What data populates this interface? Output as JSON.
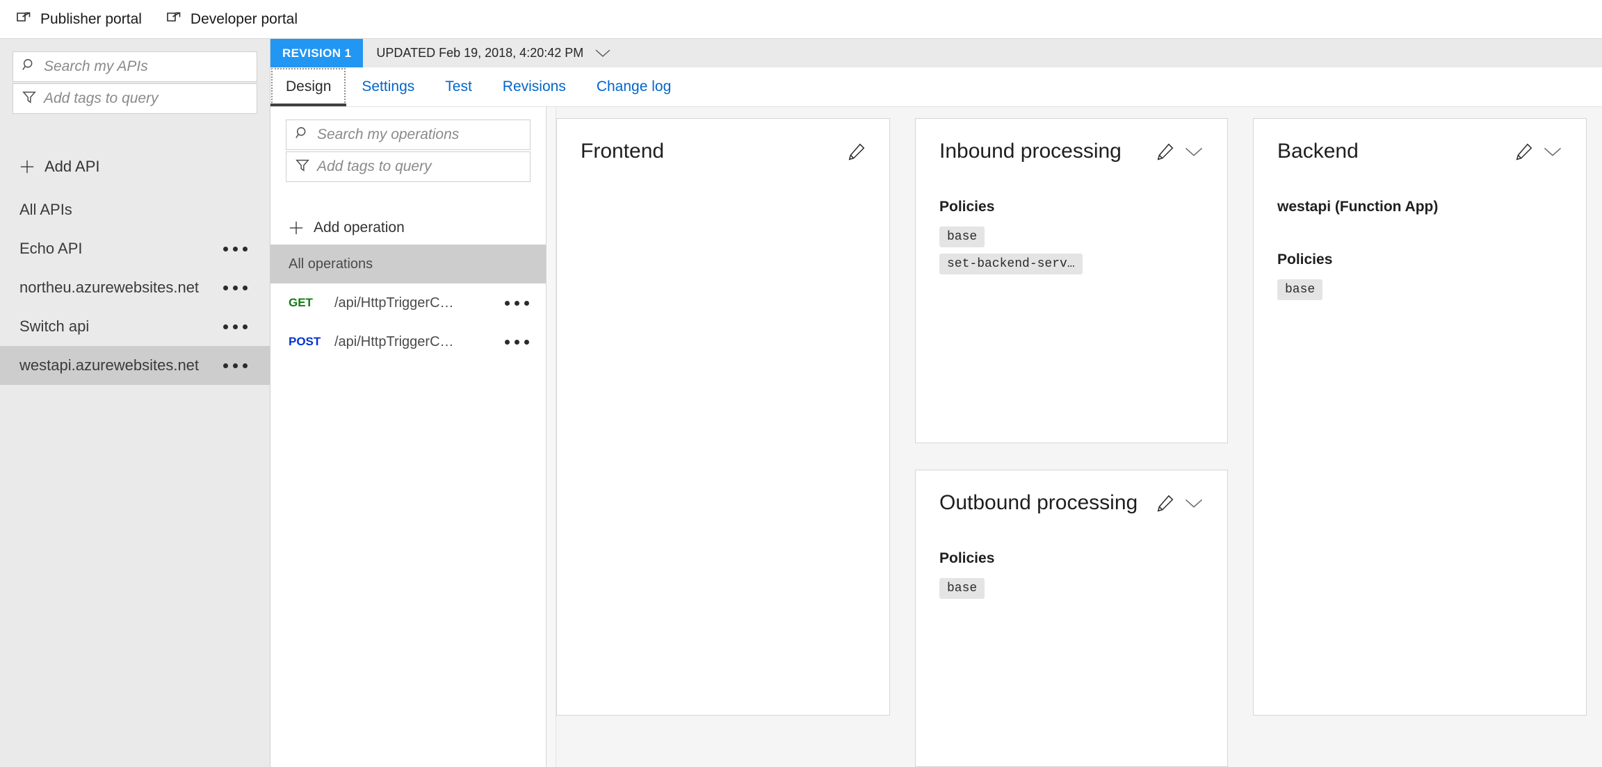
{
  "topbar": {
    "links": [
      {
        "label": "Publisher portal",
        "icon": "external-link-icon"
      },
      {
        "label": "Developer portal",
        "icon": "external-link-icon"
      }
    ]
  },
  "sidebar": {
    "search_placeholder": "Search my APIs",
    "tags_placeholder": "Add tags to query",
    "add_api_label": "Add API",
    "items": [
      {
        "label": "All APIs",
        "selected": false,
        "has_menu": false
      },
      {
        "label": "Echo API",
        "selected": false,
        "has_menu": true
      },
      {
        "label": "northeu.azurewebsites.net",
        "selected": false,
        "has_menu": true
      },
      {
        "label": "Switch api",
        "selected": false,
        "has_menu": true
      },
      {
        "label": "westapi.azurewebsites.net",
        "selected": true,
        "has_menu": true
      }
    ]
  },
  "revision_bar": {
    "badge": "REVISION 1",
    "updated": "UPDATED Feb 19, 2018, 4:20:42 PM",
    "chevron_icon": "chevron-down-icon"
  },
  "tabs": [
    {
      "label": "Design",
      "active": true
    },
    {
      "label": "Settings",
      "active": false
    },
    {
      "label": "Test",
      "active": false
    },
    {
      "label": "Revisions",
      "active": false
    },
    {
      "label": "Change log",
      "active": false
    }
  ],
  "operations": {
    "search_placeholder": "Search my operations",
    "tags_placeholder": "Add tags to query",
    "add_operation_label": "Add operation",
    "all_operations_label": "All operations",
    "rows": [
      {
        "verb": "GET",
        "path": "/api/HttpTriggerC…"
      },
      {
        "verb": "POST",
        "path": "/api/HttpTriggerC…"
      }
    ]
  },
  "cards": {
    "frontend": {
      "title": "Frontend"
    },
    "inbound": {
      "title": "Inbound processing",
      "policies_label": "Policies",
      "policies": [
        "base",
        "set-backend-serv…"
      ]
    },
    "outbound": {
      "title": "Outbound processing",
      "policies_label": "Policies",
      "policies": [
        "base"
      ]
    },
    "backend": {
      "title": "Backend",
      "name": "westapi (Function App)",
      "policies_label": "Policies",
      "policies": [
        "base"
      ]
    }
  },
  "colors": {
    "accent_blue": "#2196f3",
    "link_blue": "#0066cc",
    "get_green": "#107c10",
    "post_blue": "#0033cc",
    "selected_gray": "#cdcdcd"
  }
}
